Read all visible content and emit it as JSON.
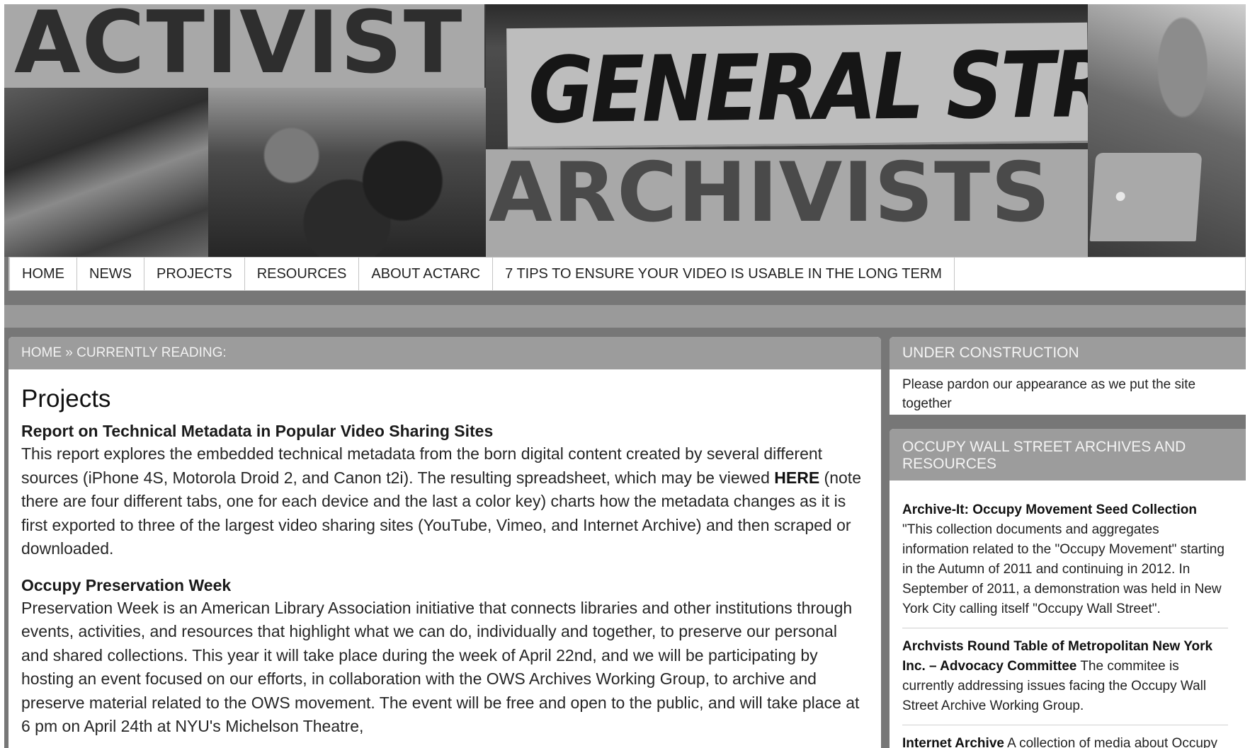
{
  "header": {
    "logo_top": "ACTIVIST",
    "logo_bottom": "ARCHIVISTS",
    "banner_sign_text": "GENERAL STRIKE!"
  },
  "nav": {
    "items": [
      "HOME",
      "NEWS",
      "PROJECTS",
      "RESOURCES",
      "ABOUT ACTARC",
      "7 TIPS TO ENSURE YOUR VIDEO IS USABLE IN THE LONG TERM"
    ]
  },
  "breadcrumb": {
    "home": "HOME",
    "separator": " » ",
    "current": "CURRENTLY READING:"
  },
  "main": {
    "title": "Projects",
    "projects": [
      {
        "title": "Report on Technical Metadata in Popular Video Sharing Sites",
        "body_before_link": "This report explores the embedded technical metadata from the born digital content created by several different sources (iPhone 4S, Motorola Droid 2, and Canon t2i). The resulting spreadsheet, which may be viewed ",
        "link_text": "HERE",
        "body_after_link": " (note there are four different tabs, one for each device and the last a color key) charts how the metadata changes as it is first exported to three of the largest video sharing sites (YouTube, Vimeo, and Internet Archive) and then scraped or downloaded."
      },
      {
        "title": "Occupy Preservation Week",
        "body": "Preservation Week is an American Library Association initiative that connects libraries and other institutions through events, activities, and resources that highlight what we can do, individually and together, to preserve our personal and shared collections. This year it will take place during the week of April 22nd, and we will be participating by hosting an event focused on our efforts, in collaboration with the OWS Archives Working Group, to archive and preserve material related to the OWS movement. The event will be free and open to the public, and will take place at 6 pm on April 24th at NYU's Michelson Theatre,"
      }
    ]
  },
  "sidebar": {
    "construction": {
      "title": "UNDER CONSTRUCTION",
      "body": "Please pardon our appearance as we put the site together"
    },
    "resources": {
      "title": "OCCUPY WALL STREET ARCHIVES AND RESOURCES",
      "items": [
        {
          "name": "Archive-It: Occupy Movement Seed Collection",
          "description": " \"This collection documents and aggregates information related to the \"Occupy Movement\" starting in the Autumn of 2011 and continuing in 2012. In September of 2011, a demonstration was held in New York City calling itself \"Occupy Wall Street\"."
        },
        {
          "name": "Archvists Round Table of Metropolitan New York Inc. – Advocacy Committee",
          "description": " The commitee is currently addressing issues facing the Occupy Wall Street Archive Working Group."
        },
        {
          "name": "Internet Archive",
          "description": " A collection of media about Occupy Wall Street and related Occupy movements"
        }
      ]
    }
  }
}
